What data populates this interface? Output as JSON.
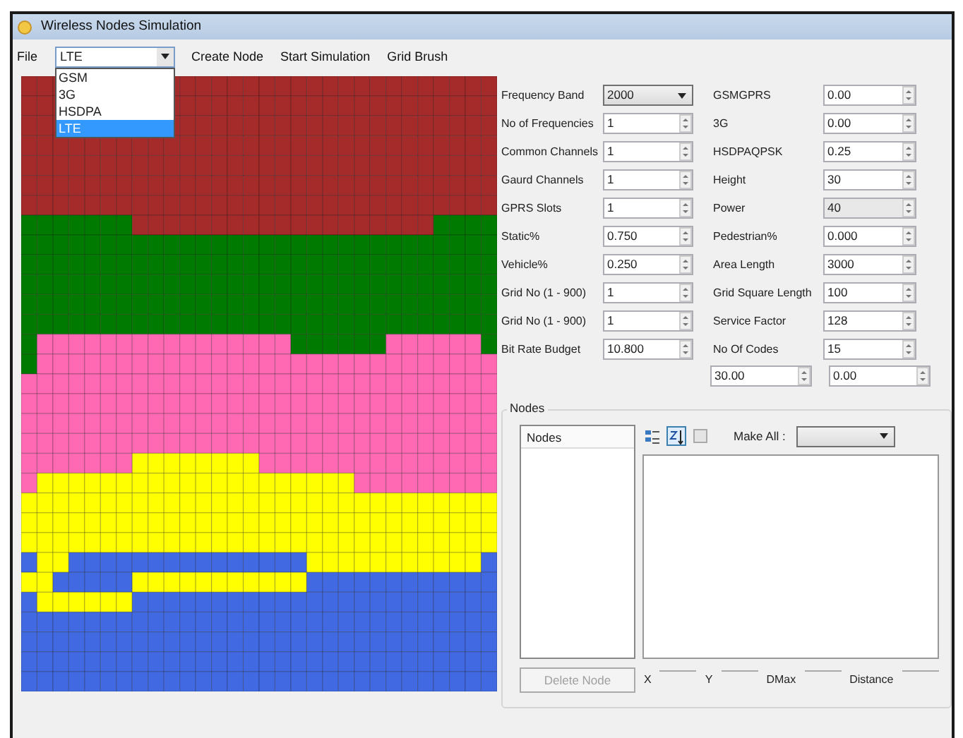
{
  "window": {
    "title": "Wireless Nodes Simulation"
  },
  "menu": {
    "file": "File",
    "network_combo": {
      "value": "LTE",
      "expanded": true,
      "options": [
        {
          "label": "GSM",
          "selected": false
        },
        {
          "label": "3G",
          "selected": false
        },
        {
          "label": "HSDPA",
          "selected": false
        },
        {
          "label": "LTE",
          "selected": true
        }
      ]
    },
    "items": [
      "Create Node",
      "Start Simulation",
      "Grid Brush"
    ]
  },
  "parameters_left": [
    {
      "label": "Frequency Band",
      "value": "2000",
      "kind": "dropdown"
    },
    {
      "label": "No of Frequencies",
      "value": "1",
      "kind": "spinner"
    },
    {
      "label": "Common Channels",
      "value": "1",
      "kind": "spinner"
    },
    {
      "label": "Gaurd Channels",
      "value": "1",
      "kind": "spinner"
    },
    {
      "label": "GPRS Slots",
      "value": "1",
      "kind": "spinner"
    },
    {
      "label": "Static%",
      "value": "0.750",
      "kind": "spinner"
    },
    {
      "label": "Vehicle%",
      "value": "0.250",
      "kind": "spinner"
    },
    {
      "label": "Grid No (1 - 900)",
      "value": "1",
      "kind": "spinner"
    },
    {
      "label": "Grid No (1 - 900)",
      "value": "1",
      "kind": "spinner"
    },
    {
      "label": "Bit Rate Budget",
      "value": "10.800",
      "kind": "spinner"
    }
  ],
  "parameters_right": [
    {
      "label": "GSMGPRS",
      "value": "0.00",
      "disabled": false
    },
    {
      "label": "3G",
      "value": "0.00",
      "disabled": false
    },
    {
      "label": "HSDPAQPSK",
      "value": "0.25",
      "disabled": false
    },
    {
      "label": "Height",
      "value": "30",
      "disabled": false
    },
    {
      "label": "Power",
      "value": "40",
      "disabled": true
    },
    {
      "label": "Pedestrian%",
      "value": "0.000",
      "disabled": false
    },
    {
      "label": "Area Length",
      "value": "3000",
      "disabled": false
    },
    {
      "label": "Grid Square Length",
      "value": "100",
      "disabled": false
    },
    {
      "label": "Service Factor",
      "value": "128",
      "disabled": false
    },
    {
      "label": "No Of Codes",
      "value": "15",
      "disabled": false
    }
  ],
  "extra_values": [
    "30.00",
    "0.00"
  ],
  "nodes_group": {
    "title": "Nodes",
    "list_header": "Nodes",
    "property_toolbar": [
      {
        "kind": "categorized",
        "selected": false
      },
      {
        "kind": "alphabetical",
        "selected": true
      },
      {
        "kind": "pages",
        "selected": false
      }
    ],
    "make_all_label": "Make All :",
    "delete_button": {
      "label": "Delete Node",
      "disabled": true
    },
    "coords": [
      "X",
      "Y",
      "DMax",
      "Distance"
    ]
  }
}
